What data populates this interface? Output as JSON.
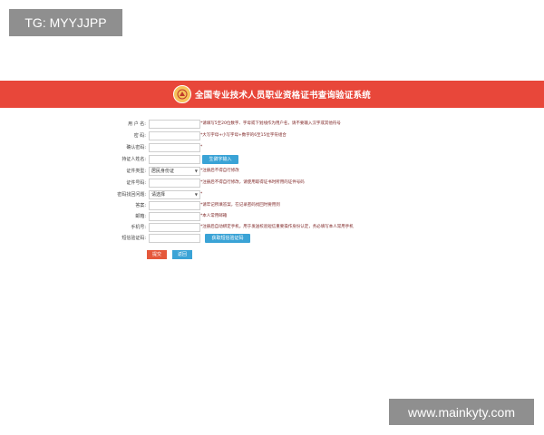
{
  "watermarks": {
    "top_left": "TG: MYYJJPP",
    "bottom_right": "www.mainkyty.com"
  },
  "header": {
    "logo_icon": "emblem-icon",
    "title": "全国专业技术人员职业资格证书查询验证系统"
  },
  "form": {
    "username": {
      "label": "用 户 名:",
      "hint": "*请填写5至20位数字、字母或下划线作为用户名，请不要输入汉字或其他符号"
    },
    "password": {
      "label": "密    码:",
      "hint": "*大写字母+小写字母+数字的6至15位字符组合"
    },
    "confirm_password": {
      "label": "确认密码:",
      "hint": "*"
    },
    "holder_name": {
      "label": "持证人姓名:",
      "button": "生僻字输入"
    },
    "id_type": {
      "label": "证件类型:",
      "selected": "居民身份证",
      "hint": "*注册后不得自行修改"
    },
    "id_number": {
      "label": "证件号码:",
      "hint": "*注册后不得自行修改，请使用取得证书时所用的证件号码"
    },
    "security_question": {
      "label": "密码找回问题:",
      "selected": "请选择",
      "hint": "*"
    },
    "answer": {
      "label": "答案:",
      "hint": "*请牢记所填答案，在记录密码找回时要用到"
    },
    "email": {
      "label": "邮箱:",
      "hint": "*本人常用邮箱"
    },
    "phone": {
      "label": "手机号:",
      "hint": "*注册后自动绑定手机，用于发送校验短信重要操作身份认定，务必填写本人常用手机"
    },
    "sms_code": {
      "label": "短信验证码:",
      "button": "获取短信验证码"
    },
    "submit_label": "提交",
    "back_label": "返回"
  },
  "colors": {
    "banner": "#e8473a",
    "blue_button": "#3aa3d6",
    "submit_button": "#e5583b"
  }
}
